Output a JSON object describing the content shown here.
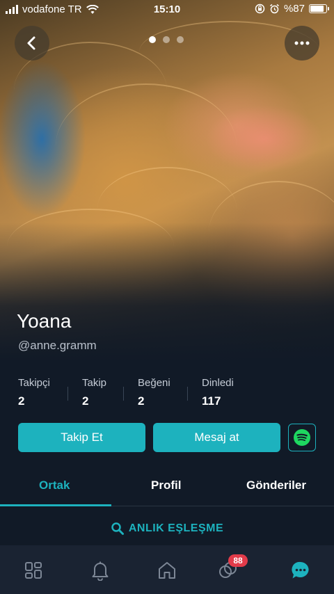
{
  "status_bar": {
    "carrier": "vodafone TR",
    "time": "15:10",
    "battery": "%87",
    "battery_level": 0.87
  },
  "photo_carousel": {
    "count": 3,
    "active": 1
  },
  "profile": {
    "name": "Yoana",
    "handle": "@anne.gramm"
  },
  "stats": [
    {
      "label": "Takipçi",
      "value": "2"
    },
    {
      "label": "Takip",
      "value": "2"
    },
    {
      "label": "Beğeni",
      "value": "2"
    },
    {
      "label": "Dinledi",
      "value": "117"
    }
  ],
  "actions": {
    "follow_label": "Takip Et",
    "message_label": "Mesaj at",
    "spotify_icon": "spotify-icon"
  },
  "tabs": [
    {
      "label": "Ortak",
      "active": true
    },
    {
      "label": "Profil",
      "active": false
    },
    {
      "label": "Gönderiler",
      "active": false
    }
  ],
  "instant_match": {
    "label": "ANLIK EŞLEŞME"
  },
  "bottom_nav": {
    "items": [
      "grid-icon",
      "bell-icon",
      "home-icon",
      "circles-icon",
      "chat-icon"
    ],
    "badge": "88"
  },
  "colors": {
    "accent": "#1db2be",
    "background": "#111a27",
    "badge": "#e23b4a",
    "spotify": "#1ed760"
  }
}
